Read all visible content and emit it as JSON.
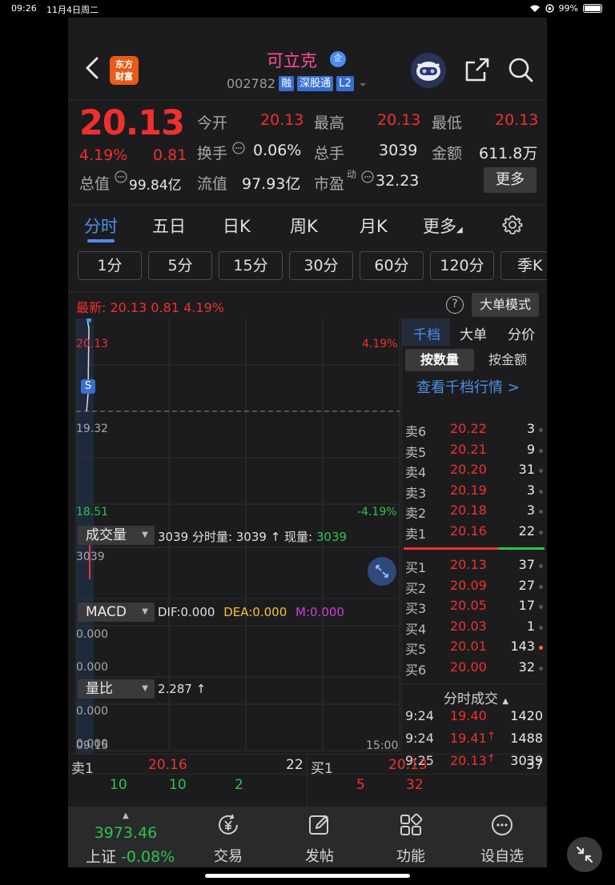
{
  "status_bar": {
    "time": "09:26",
    "date": "11月4日周二",
    "battery": "99%"
  },
  "header": {
    "logo_text_top": "东方",
    "logo_text_bottom": "财富",
    "stock_name": "可立克",
    "badge_qi": "企",
    "stock_code": "002782",
    "tags": [
      "融",
      "深股通",
      "L2"
    ]
  },
  "quote": {
    "price": "20.13",
    "change_pct": "4.19%",
    "change": "0.81",
    "fields": {
      "open_label": "今开",
      "open": "20.13",
      "high_label": "最高",
      "high": "20.13",
      "low_label": "最低",
      "low": "20.13",
      "turnover_label": "换手",
      "turnover": "0.06%",
      "volume_label": "总手",
      "volume": "3039",
      "amount_label": "金额",
      "amount": "611.8万",
      "mktcap_label": "总值",
      "mktcap": "99.84亿",
      "float_label": "流值",
      "float": "97.93亿",
      "pe_label": "市盈",
      "pe_sup": "动",
      "pe": "32.23"
    },
    "more_label": "更多"
  },
  "tabs": [
    "分时",
    "五日",
    "日K",
    "周K",
    "月K",
    "更多"
  ],
  "periods": [
    "1分",
    "5分",
    "15分",
    "30分",
    "60分",
    "120分",
    "季K"
  ],
  "latest": {
    "label": "最新:",
    "price": "20.13",
    "change": "0.81",
    "pct": "4.19%",
    "help": "?",
    "mode_label": "大单模式"
  },
  "price_chart": {
    "top_left": "20.13",
    "top_right": "4.19%",
    "mid_left": "19.32",
    "bottom_left": "18.51",
    "bottom_right": "-4.19%",
    "marker": "S"
  },
  "volume_panel": {
    "selector": "成交量",
    "info_prefix": "3039 分时量: 3039 ↑ 现量: ",
    "info_now": "3039",
    "axis_top": "3039"
  },
  "macd_panel": {
    "selector": "MACD",
    "dif": "DIF:0.000",
    "dea": "DEA:0.000",
    "m": "M:0.000",
    "axis_top": "0.000",
    "axis_bottom": "0.000"
  },
  "ratio_panel": {
    "selector": "量比",
    "info": "2.287 ↑",
    "axis_top": "0.000",
    "axis_bottom": "0.000"
  },
  "time_axis": {
    "start": "09:15",
    "end": "15:00"
  },
  "side_panel": {
    "tabs": [
      "千档",
      "大单",
      "分价"
    ],
    "subtabs": [
      "按数量",
      "按金额"
    ],
    "link": "查看千档行情 >",
    "asks": [
      {
        "k": "卖6",
        "p": "20.22",
        "v": "3"
      },
      {
        "k": "卖5",
        "p": "20.21",
        "v": "9"
      },
      {
        "k": "卖4",
        "p": "20.20",
        "v": "31"
      },
      {
        "k": "卖3",
        "p": "20.19",
        "v": "3"
      },
      {
        "k": "卖2",
        "p": "20.18",
        "v": "3"
      },
      {
        "k": "卖1",
        "p": "20.16",
        "v": "22"
      }
    ],
    "bids": [
      {
        "k": "买1",
        "p": "20.13",
        "v": "37"
      },
      {
        "k": "买2",
        "p": "20.09",
        "v": "27"
      },
      {
        "k": "买3",
        "p": "20.05",
        "v": "17"
      },
      {
        "k": "买4",
        "p": "20.03",
        "v": "1"
      },
      {
        "k": "买5",
        "p": "20.01",
        "v": "143"
      },
      {
        "k": "买6",
        "p": "20.00",
        "v": "32"
      }
    ],
    "trades_title": "分时成交",
    "trades": [
      {
        "t": "9:24",
        "p": "19.40",
        "v": "1420"
      },
      {
        "t": "9:24",
        "p": "19.41",
        "v": "1488"
      },
      {
        "t": "9:25",
        "p": "20.13",
        "v": "3039"
      }
    ]
  },
  "bottom_book": {
    "sell_label": "卖1",
    "sell_price": "20.16",
    "sell_vol": "22",
    "buy_label": "买1",
    "buy_price": "20.13",
    "buy_vol": "37",
    "sell_details": [
      "10",
      "10",
      "2"
    ],
    "buy_details": [
      "5",
      "32"
    ]
  },
  "navbar": {
    "index_value": "3973.46",
    "index_label": "上证",
    "index_pct": "-0.08%",
    "items": [
      "交易",
      "发帖",
      "功能",
      "设自选"
    ]
  }
}
